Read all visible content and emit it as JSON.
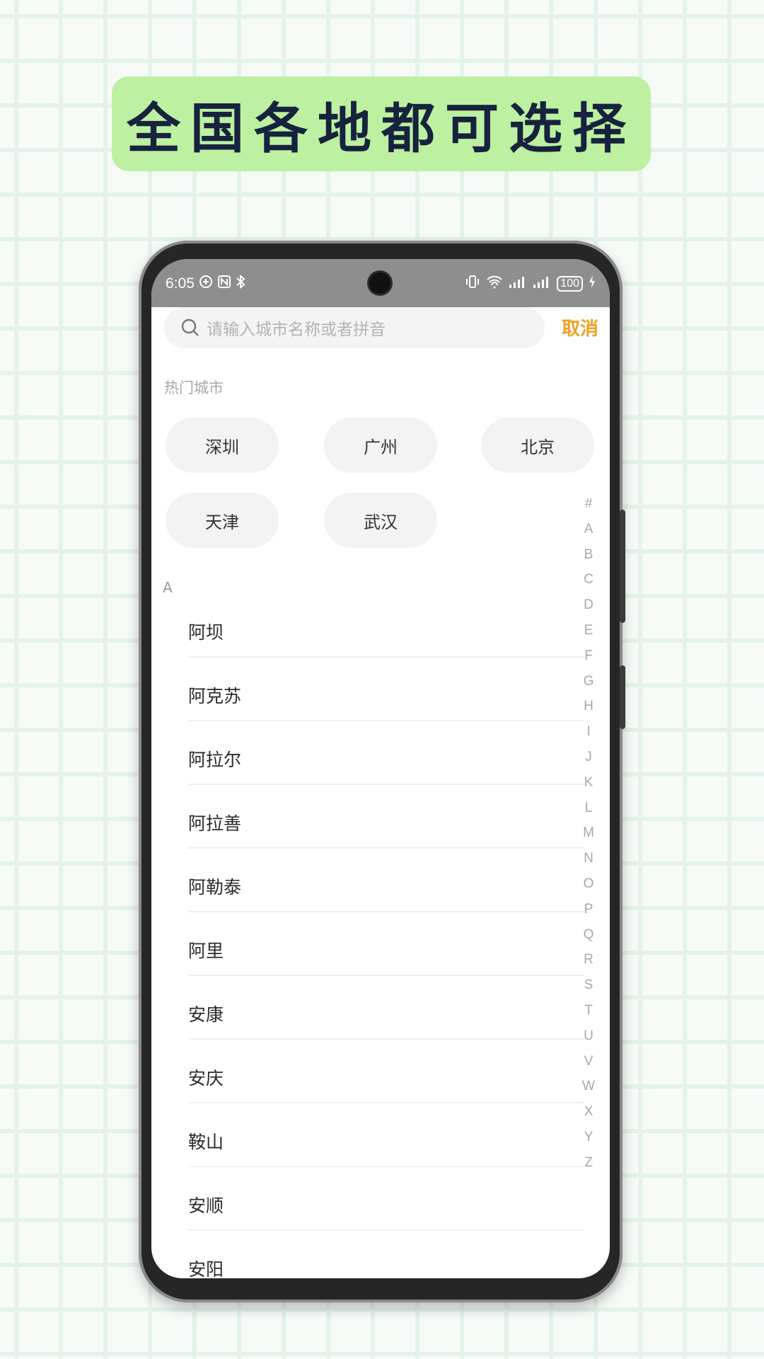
{
  "banner": {
    "title": "全国各地都可选择"
  },
  "status_bar": {
    "time": "6:05",
    "left_icons": [
      "sync-icon",
      "nfc-icon",
      "bluetooth-icon"
    ],
    "battery": "100",
    "right_icons": [
      "vibrate-icon",
      "wifi-icon",
      "signal-icon",
      "signal-icon",
      "charging-icon"
    ]
  },
  "search": {
    "placeholder": "请输入城市名称或者拼音",
    "cancel_label": "取消",
    "accent_color": "#f0a020"
  },
  "hot": {
    "label": "热门城市",
    "cities": [
      "深圳",
      "广州",
      "北京",
      "天津",
      "武汉"
    ]
  },
  "section": {
    "letter": "A"
  },
  "cities": [
    "阿坝",
    "阿克苏",
    "阿拉尔",
    "阿拉善",
    "阿勒泰",
    "阿里",
    "安康",
    "安庆",
    "鞍山",
    "安顺",
    "安阳"
  ],
  "index_letters": [
    "#",
    "A",
    "B",
    "C",
    "D",
    "E",
    "F",
    "G",
    "H",
    "I",
    "J",
    "K",
    "L",
    "M",
    "N",
    "O",
    "P",
    "Q",
    "R",
    "S",
    "T",
    "U",
    "V",
    "W",
    "X",
    "Y",
    "Z"
  ]
}
